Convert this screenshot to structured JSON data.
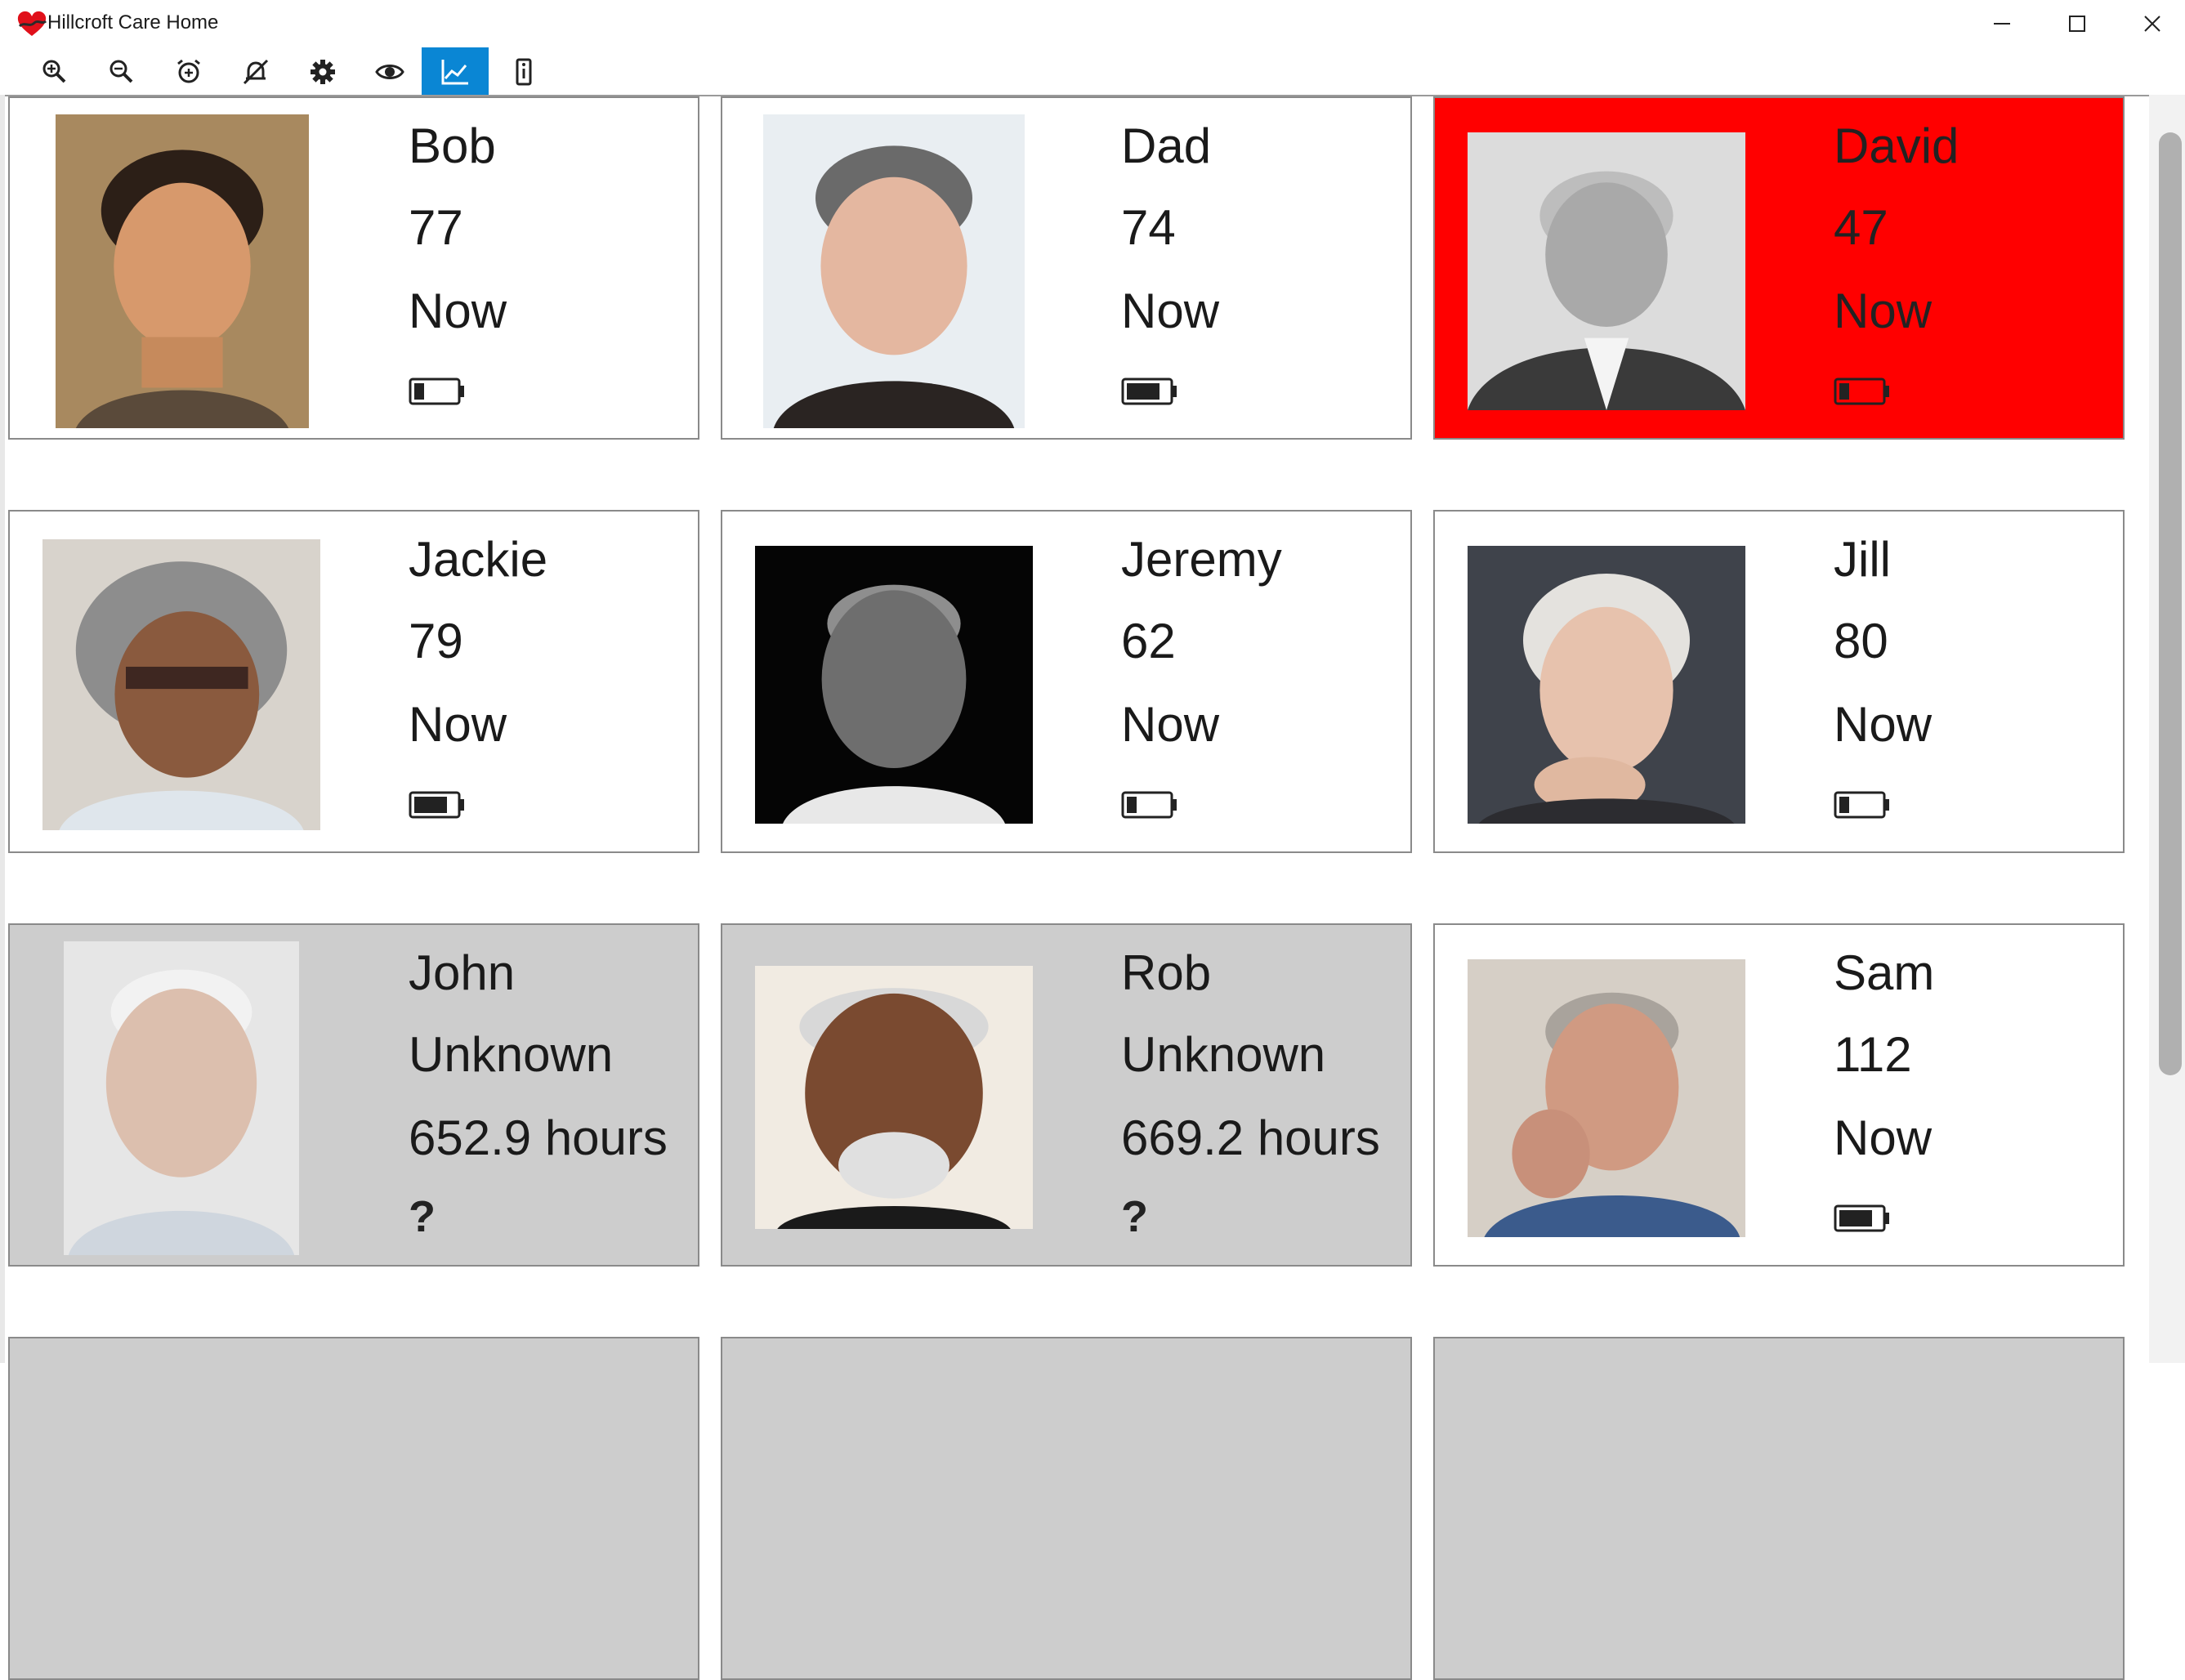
{
  "window": {
    "title": "Hillcroft Care Home",
    "icons": [
      "heart-app-icon",
      "minimize-icon",
      "maximize-icon",
      "close-icon"
    ]
  },
  "toolbar": {
    "buttons": [
      {
        "name": "zoom-in-icon"
      },
      {
        "name": "zoom-out-icon"
      },
      {
        "name": "add-alarm-icon"
      },
      {
        "name": "alarm-off-icon"
      },
      {
        "name": "settings-gear-icon"
      },
      {
        "name": "eye-icon"
      },
      {
        "name": "chart-trend-icon",
        "active": true
      },
      {
        "name": "device-info-icon"
      }
    ],
    "active_color": "#0a86d4"
  },
  "residents": [
    {
      "name": "Bob",
      "age": "77",
      "last_seen": "Now",
      "battery": 0.2,
      "status": "normal"
    },
    {
      "name": "Dad",
      "age": "74",
      "last_seen": "Now",
      "battery": 0.8,
      "status": "normal"
    },
    {
      "name": "David",
      "age": "47",
      "last_seen": "Now",
      "battery": 0.2,
      "status": "alert"
    },
    {
      "name": "Jackie",
      "age": "79",
      "last_seen": "Now",
      "battery": 0.8,
      "status": "normal"
    },
    {
      "name": "Jeremy",
      "age": "62",
      "last_seen": "Now",
      "battery": 0.2,
      "status": "normal"
    },
    {
      "name": "Jill",
      "age": "80",
      "last_seen": "Now",
      "battery": 0.2,
      "status": "normal"
    },
    {
      "name": "John",
      "age": "Unknown",
      "last_seen": "652.9 hours",
      "battery": null,
      "battery_text": "?",
      "status": "offline"
    },
    {
      "name": "Rob",
      "age": "Unknown",
      "last_seen": "669.2 hours",
      "battery": null,
      "battery_text": "?",
      "status": "offline"
    },
    {
      "name": "Sam",
      "age": "112",
      "last_seen": "Now",
      "battery": 0.8,
      "status": "normal"
    }
  ],
  "colors": {
    "alert": "#ff0000",
    "offline": "#cdcdcd",
    "normal": "#ffffff"
  }
}
